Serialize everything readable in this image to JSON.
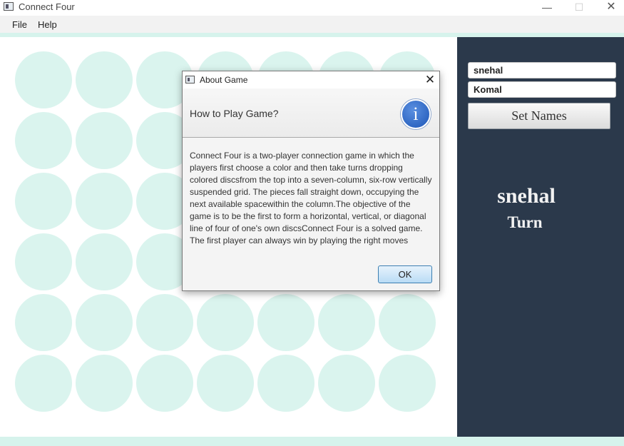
{
  "window": {
    "title": "Connect Four",
    "min_glyph": "—",
    "max_glyph": "☐",
    "close_glyph": "✕"
  },
  "menu": {
    "items": [
      "File",
      "Help"
    ]
  },
  "board": {
    "rows": 6,
    "columns": 7,
    "empty_disc_color": "#daf4ee"
  },
  "sidebar": {
    "player1_value": "snehal",
    "player2_value": "Komal",
    "set_names_label": "Set Names",
    "turn_player": "snehal",
    "turn_label": "Turn"
  },
  "dialog": {
    "title": "About Game",
    "close_glyph": "✕",
    "heading": "How to Play Game?",
    "icon": "info-icon",
    "icon_glyph": "i",
    "body": "Connect Four is a two-player connection game in which the players first choose a color and then take turns dropping colored discsfrom the top into a seven-column, six-row vertically suspended grid. The pieces fall straight down, occupying the next available spacewithin the column.The objective of the game is to be the first to form a horizontal, vertical, or diagonal line of four of one's own discsConnect Four is a solved game. The first player can always win by playing the right moves",
    "ok_label": "OK"
  },
  "colors": {
    "sidebar_bg": "#2b394b",
    "accent_strip": "#d6f3ec",
    "ok_border": "#3c7fb1"
  }
}
